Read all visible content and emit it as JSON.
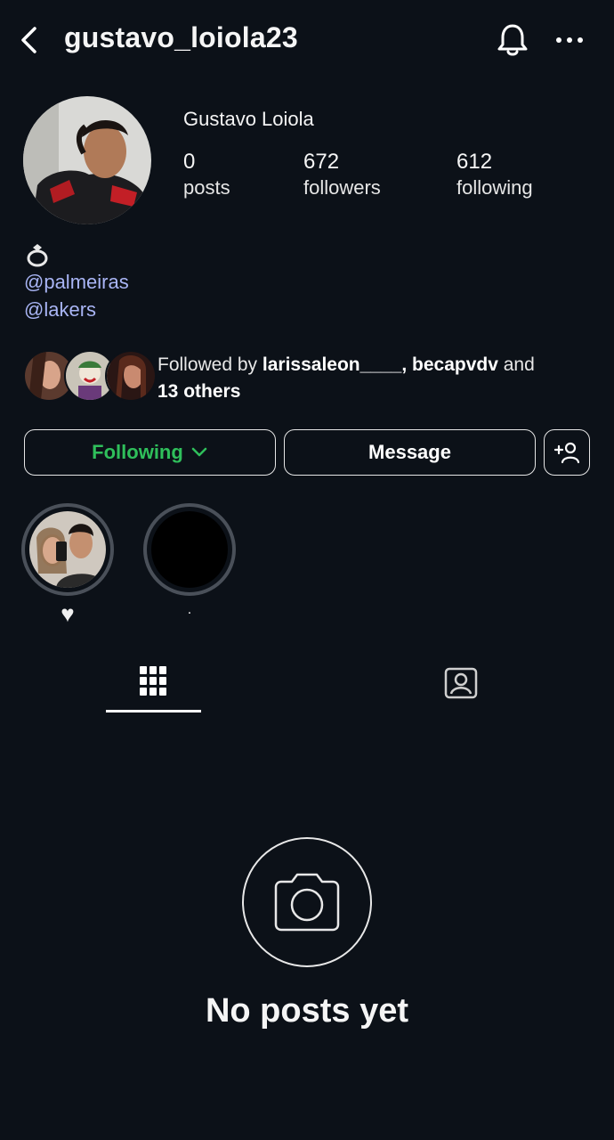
{
  "header": {
    "username": "gustavo_loiola23"
  },
  "profile": {
    "full_name": "Gustavo Loiola",
    "stats": [
      {
        "value": "0",
        "label": "posts"
      },
      {
        "value": "672",
        "label": "followers"
      },
      {
        "value": "612",
        "label": "following"
      }
    ],
    "bio_emoji_icon": "ring-icon",
    "links": [
      "@palmeiras",
      "@lakers"
    ]
  },
  "followed_by": {
    "prefix": "Followed by ",
    "names": "larissaleon____, becapvdv",
    "middle": " and",
    "others": "13 others"
  },
  "actions": {
    "following_label": "Following",
    "message_label": "Message"
  },
  "highlights": [
    {
      "label": "♥"
    },
    {
      "label": "."
    }
  ],
  "empty_state": {
    "title": "No posts yet"
  },
  "colors": {
    "background": "#0c1118",
    "following_green": "#2fbf5b",
    "link": "#a9b5f5"
  }
}
